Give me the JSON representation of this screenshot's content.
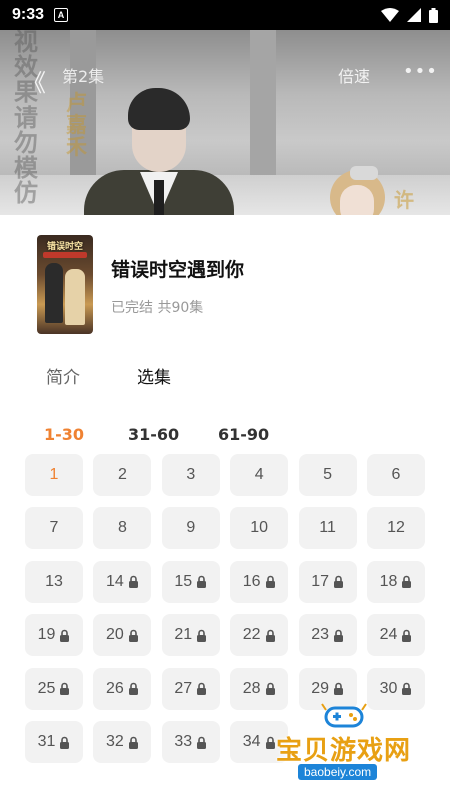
{
  "status_bar": {
    "time": "9:33",
    "app_badge": "A"
  },
  "video": {
    "episode_label": "第2集",
    "speed_label": "倍速",
    "more_label": "•••",
    "back_label": "《",
    "overlay_left": "视效果请勿模仿",
    "overlay_col2": "卢嘉禾",
    "overlay_right": "许"
  },
  "drama": {
    "title": "错误时空遇到你",
    "meta": "已完结 共90集",
    "poster_title": "错误时空"
  },
  "tabs": [
    {
      "label": "简介",
      "active": false
    },
    {
      "label": "选集",
      "active": true
    }
  ],
  "ranges": [
    {
      "label": "1-30",
      "active": true
    },
    {
      "label": "31-60",
      "active": false
    },
    {
      "label": "61-90",
      "active": false
    }
  ],
  "episodes": [
    {
      "num": "1",
      "locked": false,
      "active": true
    },
    {
      "num": "2",
      "locked": false,
      "active": false
    },
    {
      "num": "3",
      "locked": false,
      "active": false
    },
    {
      "num": "4",
      "locked": false,
      "active": false
    },
    {
      "num": "5",
      "locked": false,
      "active": false
    },
    {
      "num": "6",
      "locked": false,
      "active": false
    },
    {
      "num": "7",
      "locked": false,
      "active": false
    },
    {
      "num": "8",
      "locked": false,
      "active": false
    },
    {
      "num": "9",
      "locked": false,
      "active": false
    },
    {
      "num": "10",
      "locked": false,
      "active": false
    },
    {
      "num": "11",
      "locked": false,
      "active": false
    },
    {
      "num": "12",
      "locked": false,
      "active": false
    },
    {
      "num": "13",
      "locked": false,
      "active": false
    },
    {
      "num": "14",
      "locked": true,
      "active": false
    },
    {
      "num": "15",
      "locked": true,
      "active": false
    },
    {
      "num": "16",
      "locked": true,
      "active": false
    },
    {
      "num": "17",
      "locked": true,
      "active": false
    },
    {
      "num": "18",
      "locked": true,
      "active": false
    },
    {
      "num": "19",
      "locked": true,
      "active": false
    },
    {
      "num": "20",
      "locked": true,
      "active": false
    },
    {
      "num": "21",
      "locked": true,
      "active": false
    },
    {
      "num": "22",
      "locked": true,
      "active": false
    },
    {
      "num": "23",
      "locked": true,
      "active": false
    },
    {
      "num": "24",
      "locked": true,
      "active": false
    },
    {
      "num": "25",
      "locked": true,
      "active": false
    },
    {
      "num": "26",
      "locked": true,
      "active": false
    },
    {
      "num": "27",
      "locked": true,
      "active": false
    },
    {
      "num": "28",
      "locked": true,
      "active": false
    },
    {
      "num": "29",
      "locked": true,
      "active": false
    },
    {
      "num": "30",
      "locked": true,
      "active": false
    },
    {
      "num": "31",
      "locked": true,
      "active": false
    },
    {
      "num": "32",
      "locked": true,
      "active": false
    },
    {
      "num": "33",
      "locked": true,
      "active": false
    },
    {
      "num": "34",
      "locked": true,
      "active": false
    }
  ],
  "watermark": {
    "name": "宝贝游戏网",
    "url": "baobeiy.com"
  },
  "colors": {
    "accent": "#ef8232",
    "tile_bg": "#f2f2f2",
    "logo_blue": "#1d84d8"
  }
}
